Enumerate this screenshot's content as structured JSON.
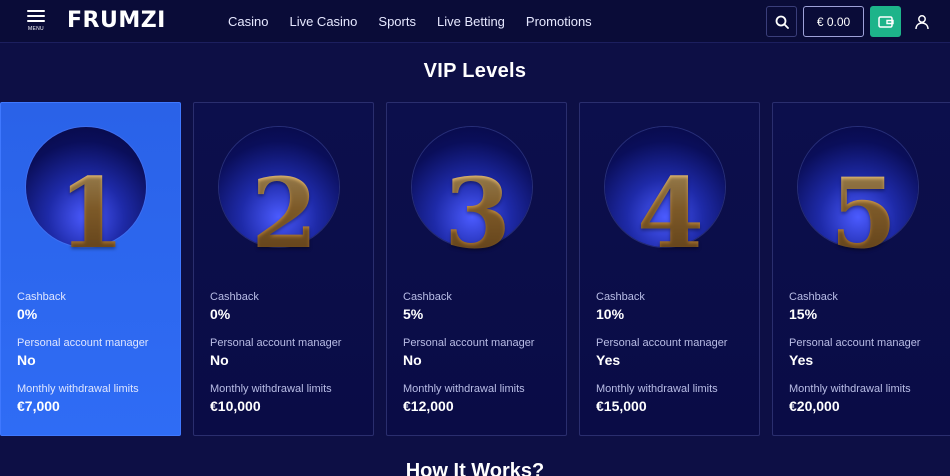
{
  "header": {
    "menu_label": "MENU",
    "logo_text": "FRUMZI",
    "nav": [
      "Casino",
      "Live Casino",
      "Sports",
      "Live Betting",
      "Promotions"
    ],
    "balance": "€ 0.00",
    "icons": {
      "search": "search-icon",
      "wallet": "wallet-icon",
      "user": "user-icon",
      "menu": "hamburger-icon"
    },
    "colors": {
      "wallet_bg": "#1db48a",
      "bg": "#0a0c38"
    }
  },
  "page_title": "VIP Levels",
  "levels": [
    {
      "number": "1",
      "cashback_label": "Cashback",
      "cashback": "0%",
      "manager_label": "Personal account manager",
      "manager": "No",
      "limit_label": "Monthly withdrawal limits",
      "limit": "€7,000",
      "active": true
    },
    {
      "number": "2",
      "cashback_label": "Cashback",
      "cashback": "0%",
      "manager_label": "Personal account manager",
      "manager": "No",
      "limit_label": "Monthly withdrawal limits",
      "limit": "€10,000",
      "active": false
    },
    {
      "number": "3",
      "cashback_label": "Cashback",
      "cashback": "5%",
      "manager_label": "Personal account manager",
      "manager": "No",
      "limit_label": "Monthly withdrawal limits",
      "limit": "€12,000",
      "active": false
    },
    {
      "number": "4",
      "cashback_label": "Cashback",
      "cashback": "10%",
      "manager_label": "Personal account manager",
      "manager": "Yes",
      "limit_label": "Monthly withdrawal limits",
      "limit": "€15,000",
      "active": false
    },
    {
      "number": "5",
      "cashback_label": "Cashback",
      "cashback": "15%",
      "manager_label": "Personal account manager",
      "manager": "Yes",
      "limit_label": "Monthly withdrawal limits",
      "limit": "€20,000",
      "active": false
    }
  ],
  "next_section_title": "How It Works?",
  "colors": {
    "page_bg": "#0d0f45",
    "active_card": "#2f6cf5",
    "gold": "#c9944a"
  }
}
